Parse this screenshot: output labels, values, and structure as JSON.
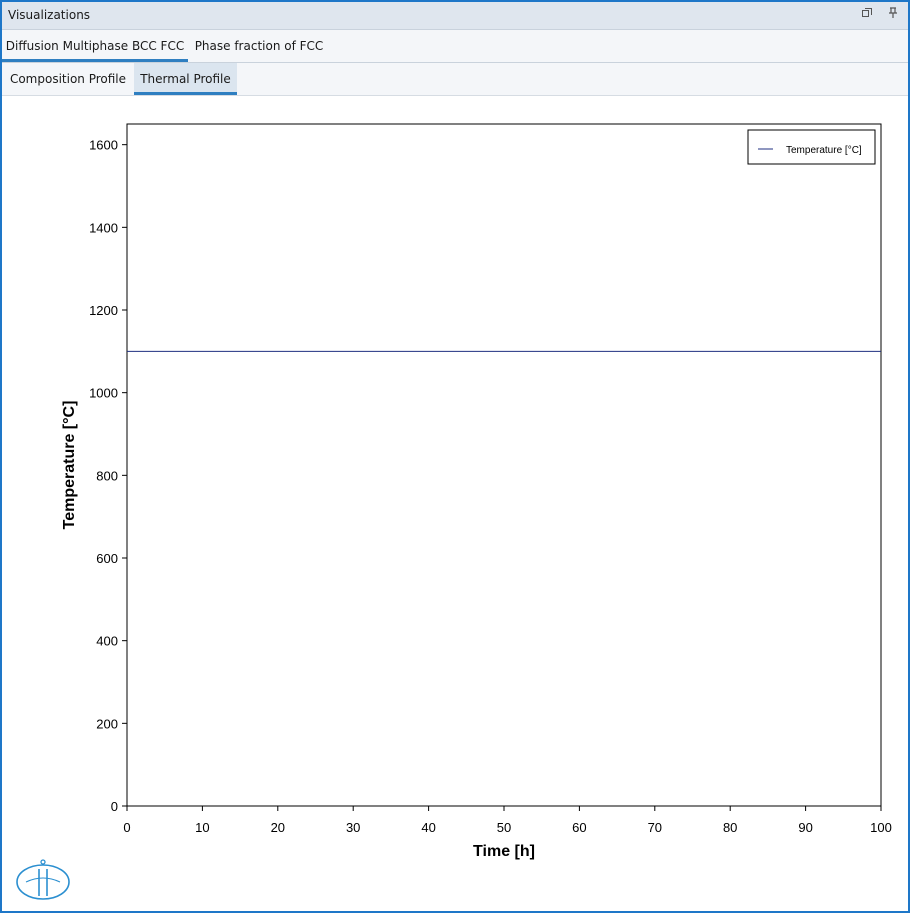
{
  "window": {
    "title": "Visualizations",
    "icons": [
      "restore-icon",
      "pin-icon"
    ]
  },
  "tabs_primary": [
    {
      "label": "Diffusion Multiphase BCC FCC",
      "active": true
    },
    {
      "label": "Phase fraction of FCC",
      "active": false
    }
  ],
  "tabs_secondary": [
    {
      "label": "Composition Profile",
      "active": false
    },
    {
      "label": "Thermal Profile",
      "active": true
    }
  ],
  "chart_data": {
    "type": "line",
    "xlabel": "Time [h]",
    "ylabel": "Temperature [°C]",
    "xlim": [
      0,
      100
    ],
    "ylim": [
      0,
      1650
    ],
    "xticks": [
      0,
      10,
      20,
      30,
      40,
      50,
      60,
      70,
      80,
      90,
      100
    ],
    "yticks": [
      0,
      200,
      400,
      600,
      800,
      1000,
      1200,
      1400,
      1600
    ],
    "grid": false,
    "legend": "top-right",
    "series": [
      {
        "name": "Temperature [°C]",
        "color": "#1f2f80",
        "x": [
          0,
          100
        ],
        "y": [
          1100,
          1100
        ]
      }
    ]
  },
  "colors": {
    "accent": "#2f7fc1",
    "border": "#1e77c8",
    "series": "#1f2f80"
  }
}
